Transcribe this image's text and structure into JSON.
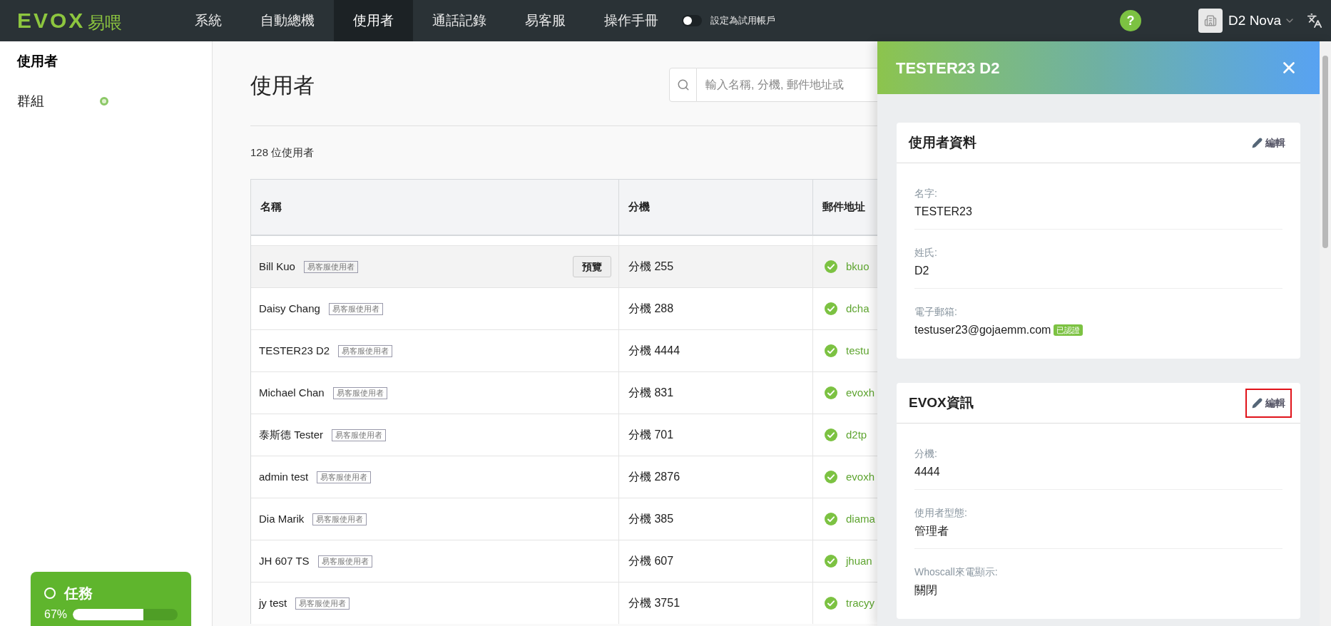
{
  "nav": {
    "logo": "EVOX",
    "logo_suffix": "易喂",
    "items": [
      {
        "label": "系統",
        "selected": false
      },
      {
        "label": "自動總機",
        "selected": false
      },
      {
        "label": "使用者",
        "selected": true
      },
      {
        "label": "通話記錄",
        "selected": false
      },
      {
        "label": "易客服",
        "selected": false
      },
      {
        "label": "操作手冊",
        "selected": false
      }
    ],
    "trial_toggle": {
      "label": "設定為試用帳戶",
      "on": false
    },
    "help": "?",
    "account": "D2 Nova"
  },
  "sidebar": {
    "items": [
      {
        "label": "使用者",
        "selected": true,
        "dot": false
      },
      {
        "label": "群組",
        "selected": false,
        "dot": true
      }
    ],
    "task": {
      "title": "任務",
      "reading": "67%",
      "level": 0.67
    }
  },
  "main": {
    "title": "使用者",
    "search": {
      "placeholder": "輸入名稱, 分機, 郵件地址或"
    },
    "count": "128 位使用者",
    "table": {
      "columns": [
        "名稱",
        "分機",
        "郵件地址"
      ],
      "rows": [
        {
          "name": "Bill Kuo",
          "tag": "易客服使用者",
          "action": "預覽",
          "hovered": true,
          "extension": "分機 255",
          "verified": true,
          "email": "bkuo"
        },
        {
          "name": "Daisy Chang",
          "tag": "易客服使用者",
          "hovered": false,
          "extension": "分機 288",
          "verified": true,
          "email": "dcha"
        },
        {
          "name": "TESTER23 D2",
          "tag": "易客服使用者",
          "hovered": false,
          "extension": "分機 4444",
          "verified": true,
          "email": "testu"
        },
        {
          "name": "Michael Chan",
          "tag": "易客服使用者",
          "hovered": false,
          "extension": "分機 831",
          "verified": true,
          "email": "evoxh"
        },
        {
          "name": "泰斯德 Tester",
          "tag": "易客服使用者",
          "hovered": false,
          "extension": "分機 701",
          "verified": true,
          "email": "d2tp"
        },
        {
          "name": "admin test",
          "tag": "易客服使用者",
          "hovered": false,
          "extension": "分機 2876",
          "verified": true,
          "email": "evoxh"
        },
        {
          "name": "Dia Marik",
          "tag": "易客服使用者",
          "hovered": false,
          "extension": "分機 385",
          "verified": true,
          "email": "diama"
        },
        {
          "name": "JH 607 TS",
          "tag": "易客服使用者",
          "hovered": false,
          "extension": "分機 607",
          "verified": true,
          "email": "jhuan"
        },
        {
          "name": "jy test",
          "tag": "易客服使用者",
          "hovered": false,
          "extension": "分機 3751",
          "verified": true,
          "email": "tracyy"
        }
      ]
    }
  },
  "panel": {
    "title": "TESTER23 D2",
    "cards": [
      {
        "title": "使用者資料",
        "edit": {
          "label": "編輯",
          "highlighted": false
        },
        "fields": [
          {
            "label": "名字:",
            "value": "TESTER23"
          },
          {
            "label": "姓氏:",
            "value": "D2"
          },
          {
            "label": "電子郵箱:",
            "value": "testuser23@gojaemm.com",
            "badge": "已認證"
          }
        ]
      },
      {
        "title": "EVOX資訊",
        "edit": {
          "label": "編輯",
          "highlighted": true
        },
        "fields": [
          {
            "label": "分機:",
            "value": "4444"
          },
          {
            "label": "使用者型態:",
            "value": "管理者"
          },
          {
            "label": "Whoscall來電顯示:",
            "value": "關閉"
          }
        ]
      }
    ]
  }
}
